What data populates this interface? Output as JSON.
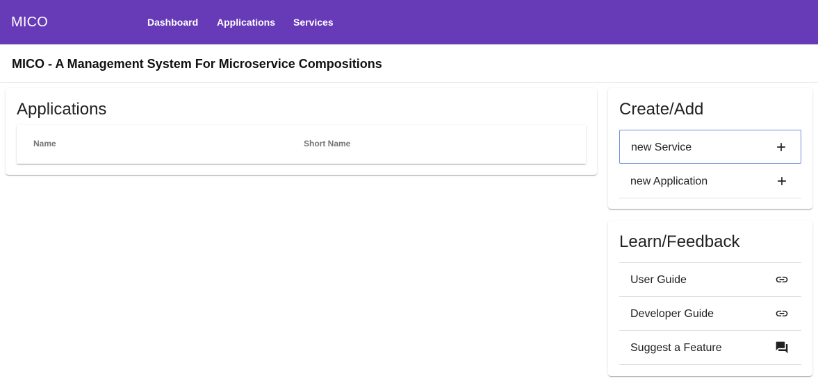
{
  "topbar": {
    "brand": "MICO",
    "nav": [
      {
        "label": "Dashboard"
      },
      {
        "label": "Applications"
      },
      {
        "label": "Services"
      }
    ],
    "color": "#673ab7"
  },
  "page": {
    "title": "MICO - A Management System For Microservice Compositions"
  },
  "applications_card": {
    "title": "Applications",
    "columns": [
      "Name",
      "Short Name"
    ]
  },
  "create_card": {
    "title": "Create/Add",
    "items": [
      {
        "label": "new Service",
        "icon": "plus-icon"
      },
      {
        "label": "new Application",
        "icon": "plus-icon"
      }
    ]
  },
  "learn_card": {
    "title": "Learn/Feedback",
    "items": [
      {
        "label": "User Guide",
        "icon": "link-icon"
      },
      {
        "label": "Developer Guide",
        "icon": "link-icon"
      },
      {
        "label": "Suggest a Feature",
        "icon": "forum-icon"
      }
    ]
  }
}
